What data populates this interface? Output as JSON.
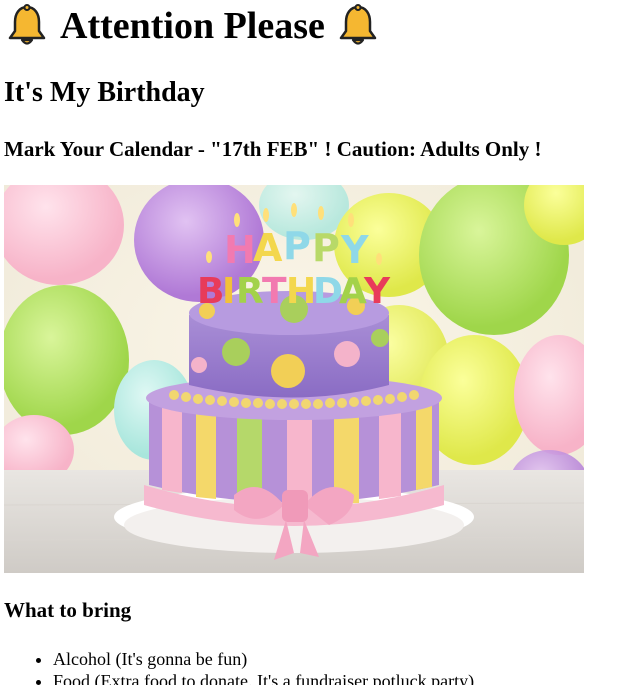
{
  "header": {
    "title": "Attention Please",
    "left_icon": "bell-icon",
    "right_icon": "bell-icon"
  },
  "subtitle": "It's My Birthday",
  "notice": "Mark Your Calendar - \"17th FEB\" ! Caution: Adults Only !",
  "image": {
    "subject": "birthday-cake-photo",
    "candle_letters": "HAPPY BIRTHDAY"
  },
  "bring_section": {
    "heading": "What to bring",
    "items": [
      "Alcohol (It's gonna be fun)",
      "Food (Extra food to donate. It's a fundraiser potluck party)"
    ]
  },
  "colors": {
    "text": "#000000",
    "background": "#ffffff",
    "bell": "#f5b731"
  }
}
